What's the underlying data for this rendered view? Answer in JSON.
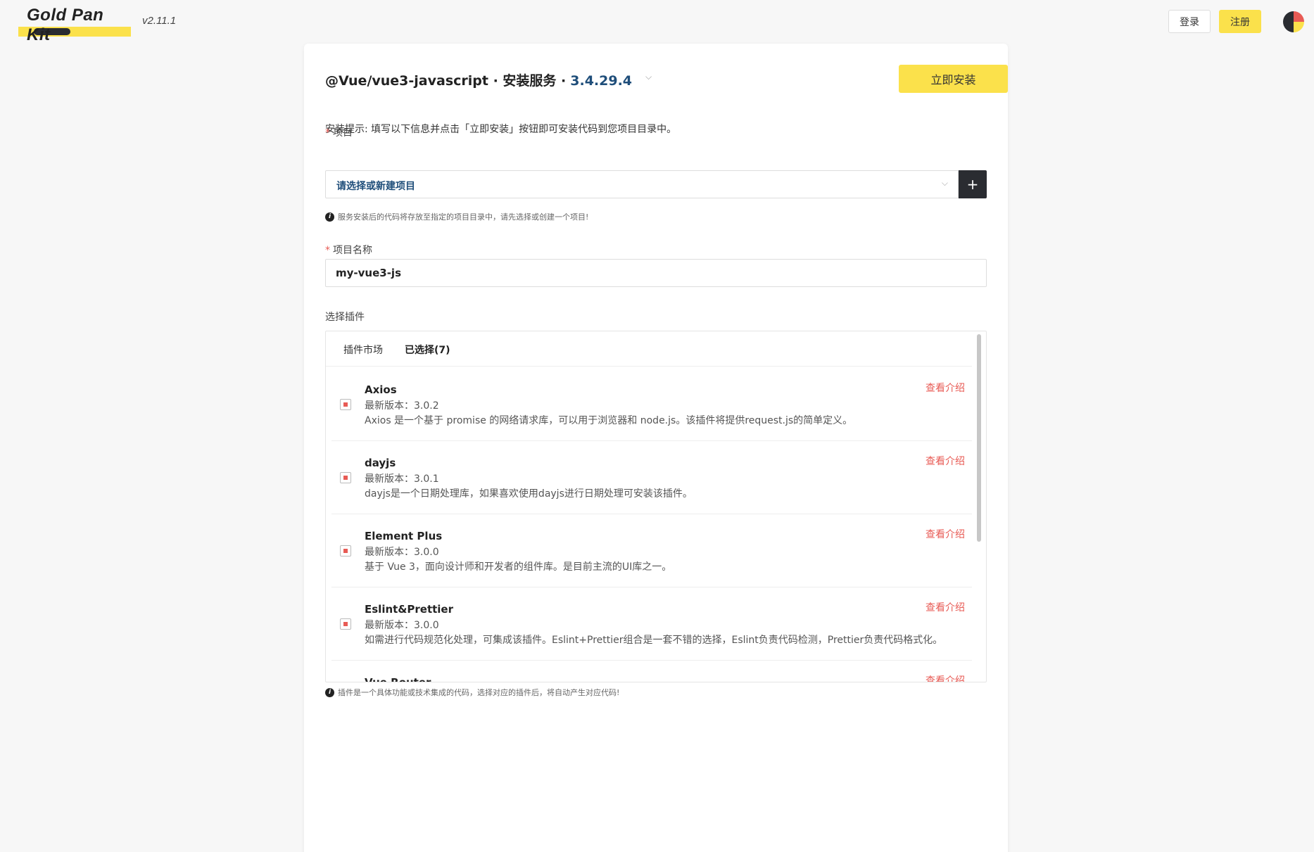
{
  "header": {
    "logo_text": "Gold Pan Kit",
    "version": "v2.11.1",
    "login_label": "登录",
    "register_label": "注册"
  },
  "card": {
    "title_prefix": "@Vue/vue3-javascript · 安装服务 ·",
    "title_version": "3.4.29.4",
    "install_label": "立即安装",
    "hint": "安装提示: 填写以下信息并点击「立即安装」按钮即可安装代码到您项目目录中。",
    "project_label": "项目",
    "project_placeholder": "请选择或新建项目",
    "project_tip": "服务安装后的代码将存放至指定的项目目录中，请先选择或创建一个项目!",
    "name_label": "项目名称",
    "name_value": "my-vue3-js",
    "plugins_label": "选择插件",
    "plugins_tip": "插件是一个具体功能或技术集成的代码，选择对应的插件后，将自动产生对应代码!",
    "tabs": [
      {
        "label": "插件市场"
      },
      {
        "label": "已选择(7)"
      }
    ],
    "plugins": [
      {
        "name": "Axios",
        "version": "最新版本：3.0.2",
        "desc": "Axios 是一个基于 promise 的网络请求库，可以用于浏览器和 node.js。该插件将提供request.js的简单定义。",
        "link": "查看介绍"
      },
      {
        "name": "dayjs",
        "version": "最新版本：3.0.1",
        "desc": "dayjs是一个日期处理库，如果喜欢使用dayjs进行日期处理可安装该插件。",
        "link": "查看介绍"
      },
      {
        "name": "Element Plus",
        "version": "最新版本：3.0.0",
        "desc": "基于 Vue 3，面向设计师和开发者的组件库。是目前主流的UI库之一。",
        "link": "查看介绍"
      },
      {
        "name": "Eslint&Prettier",
        "version": "最新版本：3.0.0",
        "desc": "如需进行代码规范化处理，可集成该插件。Eslint+Prettier组合是一套不错的选择，Eslint负责代码检测，Prettier负责代码格式化。",
        "link": "查看介绍"
      },
      {
        "name": "Vue Router",
        "version": "",
        "desc": "",
        "link": "查看介绍"
      }
    ]
  }
}
